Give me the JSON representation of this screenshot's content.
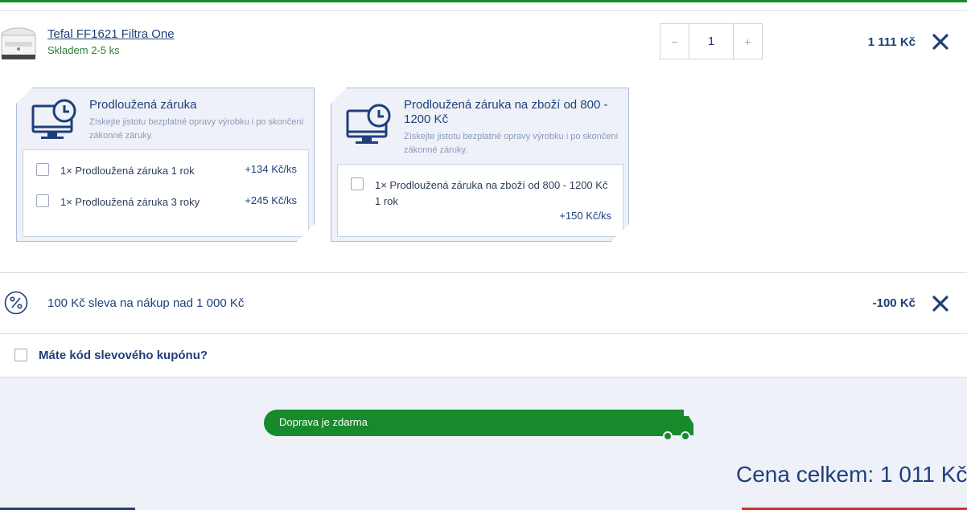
{
  "product": {
    "name": "Tefal FF1621 Filtra One",
    "stock": "Skladem 2-5 ks",
    "quantity": "1",
    "qty_minus": "−",
    "qty_plus": "+",
    "price": "1 111 Kč"
  },
  "warranties": [
    {
      "title": "Prodloužená záruka",
      "description": "Získejte jistotu bezplatné opravy výrobku i po skončení zákonné záruky.",
      "options": [
        {
          "label": "1× Prodloužená záruka 1 rok",
          "price": "+134 Kč/ks"
        },
        {
          "label": "1× Prodloužená záruka 3 roky",
          "price": "+245 Kč/ks"
        }
      ]
    },
    {
      "title": "Prodloužená záruka na zboží od 800 - 1200 Kč",
      "description": "Získejte jistotu bezplatné opravy výrobku i po skončení zákonné záruky.",
      "options": [
        {
          "label": "1× Prodloužená záruka na zboží od 800 - 1200 Kč 1 rok",
          "price": "+150 Kč/ks"
        }
      ]
    }
  ],
  "discount": {
    "label": "100 Kč sleva na nákup nad 1 000 Kč",
    "value": "-100 Kč"
  },
  "coupon": {
    "label": "Máte kód slevového kupónu?"
  },
  "shipping": {
    "label": "Doprava je zdarma"
  },
  "total": {
    "label": "Cena celkem: 1 011 Kč"
  },
  "colors": {
    "primary": "#1f3f7a",
    "green": "#178a2b",
    "card_bg": "#eef1f8",
    "card_border": "#a9bde0"
  },
  "icons": [
    "product-image",
    "monitor-clock-icon",
    "close-icon",
    "percent-icon",
    "truck-icon"
  ]
}
